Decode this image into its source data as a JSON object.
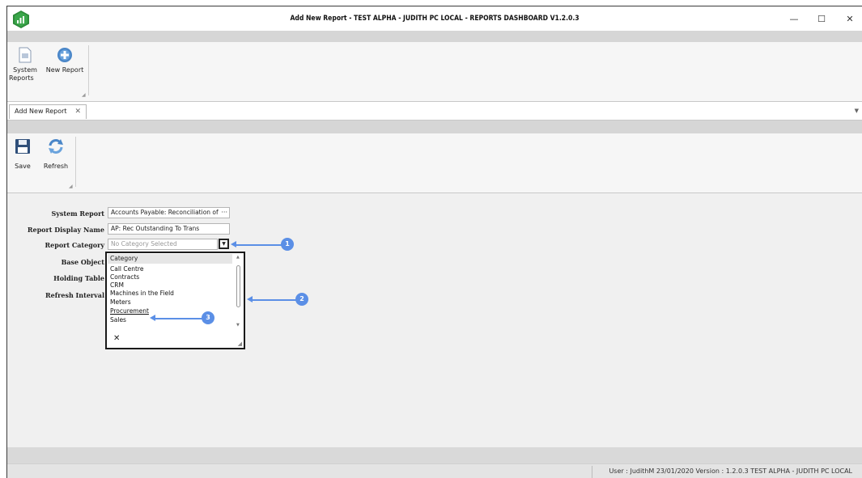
{
  "window": {
    "title": "Add New Report - TEST ALPHA - JUDITH PC LOCAL - REPORTS DASHBOARD V1.2.0.3",
    "minimize_glyph": "—",
    "maximize_glyph": "☐",
    "close_glyph": "✕"
  },
  "ribbon_top": {
    "buttons": [
      {
        "label_line1": "System",
        "label_line2": "Reports",
        "icon": "document-icon"
      },
      {
        "label_line1": "New Report",
        "label_line2": "",
        "icon": "plus-circle-icon"
      }
    ]
  },
  "tabs": [
    {
      "label": "Add New Report",
      "close": "✕"
    }
  ],
  "ribbon_doc": {
    "buttons": [
      {
        "label": "Save",
        "icon": "floppy-disk-icon"
      },
      {
        "label": "Refresh",
        "icon": "refresh-icon"
      }
    ]
  },
  "form": {
    "system_report_label": "System Report",
    "system_report_value": "Accounts Payable: Reconciliation of",
    "system_report_more": "···",
    "display_name_label": "Report Display Name",
    "display_name_value": "AP: Rec Outstanding To Trans",
    "category_label": "Report Category",
    "category_placeholder": "No Category Selected",
    "base_object_label": "Base Object",
    "holding_table_label": "Holding Table",
    "refresh_interval_label": "Refresh Interval"
  },
  "category_dropdown": {
    "header": "Category",
    "items": [
      "Call Centre",
      "Contracts",
      "CRM",
      "Machines in the Field",
      "Meters",
      "Procurement",
      "Sales"
    ],
    "highlighted": "Procurement",
    "clear": "✕"
  },
  "callouts": [
    "1",
    "2",
    "3"
  ],
  "status": {
    "text": "User : JudithM   23/01/2020   Version : 1.2.0.3   TEST ALPHA - JUDITH PC LOCAL"
  },
  "colors": {
    "callout": "#5b8fe6",
    "logo_green": "#2e8b3a"
  }
}
